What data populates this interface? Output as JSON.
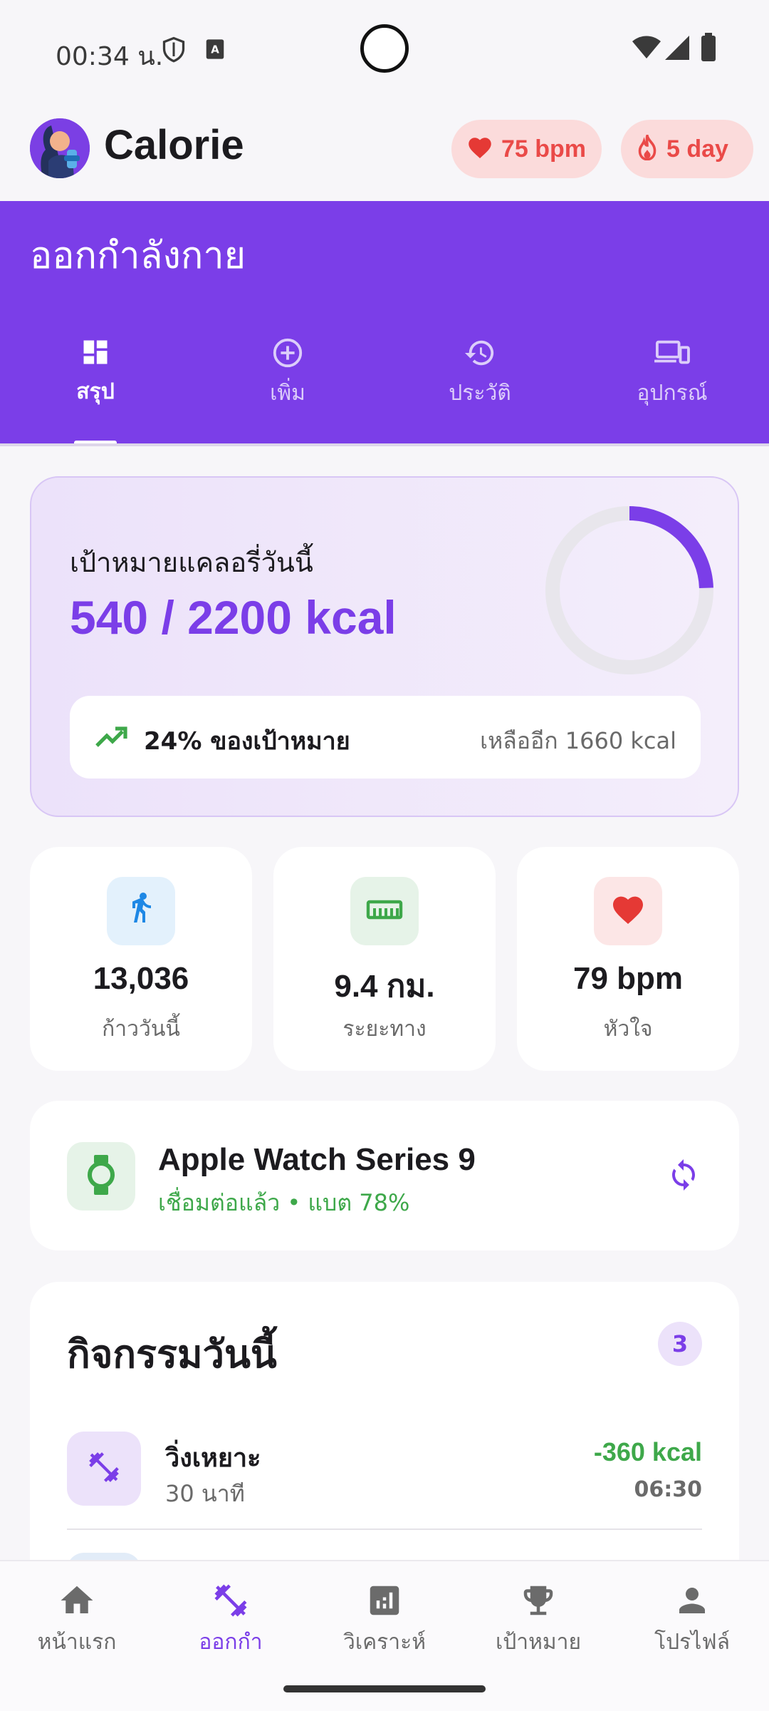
{
  "status_bar": {
    "time": "00:34 น."
  },
  "app": {
    "title": "Calorie",
    "heart_chip": "75 bpm",
    "streak_chip": "5 day"
  },
  "header": {
    "title": "ออกกำลังกาย",
    "tabs": [
      {
        "label": "สรุป",
        "icon": "dashboard-icon",
        "active": true
      },
      {
        "label": "เพิ่ม",
        "icon": "add-circle-icon",
        "active": false
      },
      {
        "label": "ประวัติ",
        "icon": "history-icon",
        "active": false
      },
      {
        "label": "อุปกรณ์",
        "icon": "devices-icon",
        "active": false
      }
    ]
  },
  "goal": {
    "label": "เป้าหมายแคลอรี่วันนี้",
    "value": "540 / 2200 kcal",
    "consumed": 540,
    "target": 2200,
    "progress_fraction": 0.245,
    "percent_text": "24% ของเป้าหมาย",
    "remaining_text": "เหลืออีก 1660 kcal"
  },
  "stats": [
    {
      "value": "13,036",
      "caption": "ก้าววันนี้",
      "icon": "walk-icon",
      "color": "#1e88e5",
      "bg": "#e3f1fc"
    },
    {
      "value": "9.4 กม.",
      "caption": "ระยะทาง",
      "icon": "ruler-icon",
      "color": "#3ea84a",
      "bg": "#e6f3e8"
    },
    {
      "value": "79 bpm",
      "caption": "หัวใจ",
      "icon": "heart-icon",
      "color": "#e53935",
      "bg": "#fce6e6"
    }
  ],
  "device": {
    "name": "Apple Watch Series 9",
    "status": "เชื่อมต่อแล้ว • แบต 78%"
  },
  "activities": {
    "title": "กิจกรรมวันนี้",
    "count": "3",
    "items": [
      {
        "name": "วิ่งเหยาะ",
        "duration": "30 นาที",
        "kcal": "-360 kcal",
        "time": "06:30",
        "icon": "dumbbell-icon"
      }
    ]
  },
  "bottom_nav": [
    {
      "label": "หน้าแรก",
      "icon": "home-icon",
      "active": false
    },
    {
      "label": "ออกกำ",
      "icon": "fitness-icon",
      "active": true
    },
    {
      "label": "วิเคราะห์",
      "icon": "analytics-icon",
      "active": false
    },
    {
      "label": "เป้าหมาย",
      "icon": "trophy-icon",
      "active": false
    },
    {
      "label": "โปรไฟล์",
      "icon": "person-icon",
      "active": false
    }
  ],
  "colors": {
    "primary": "#7b3ee8",
    "green": "#3ea84a",
    "red": "#ea4a48"
  }
}
